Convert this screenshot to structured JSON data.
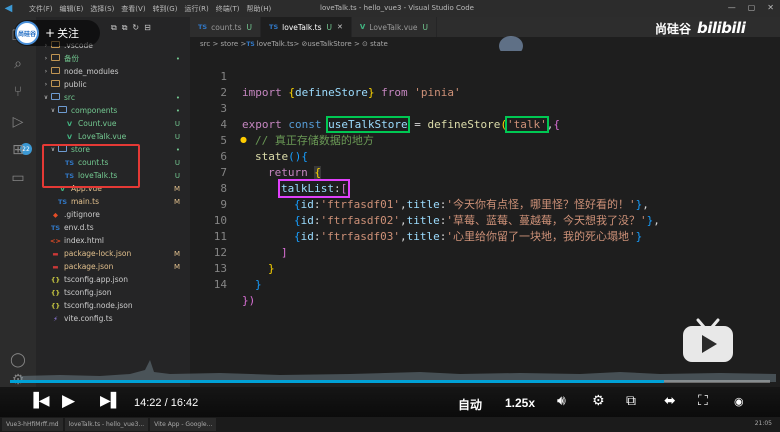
{
  "window": {
    "title": "loveTalk.ts - hello_vue3 - Visual Studio Code",
    "menu": [
      "文件(F)",
      "编辑(E)",
      "选择(S)",
      "查看(V)",
      "转到(G)",
      "运行(R)",
      "终端(T)",
      "帮助(H)"
    ]
  },
  "follow": {
    "avatar_text": "尚硅谷",
    "label": "关注",
    "plus": "+"
  },
  "brand": {
    "name": "尚硅谷",
    "logo": "bilibili"
  },
  "tabs": [
    {
      "label": "count.ts",
      "lang": "TS",
      "status": "U",
      "active": false
    },
    {
      "label": "loveTalk.ts",
      "lang": "TS",
      "status": "U",
      "active": true
    },
    {
      "label": "LoveTalk.vue",
      "lang": "V",
      "status": "U",
      "active": false
    }
  ],
  "breadcrumb": {
    "path": "src > store > ",
    "lang": "TS",
    "file": "loveTalk.ts",
    "rest": " > ⊘useTalkStore > ⊙ state"
  },
  "explorer": {
    "items": [
      {
        "name": ".vscode",
        "type": "folder",
        "chev": "›",
        "badge": ""
      },
      {
        "name": "备份",
        "type": "folder",
        "chev": "›",
        "badge": "•"
      },
      {
        "name": "node_modules",
        "type": "folder",
        "chev": "›",
        "badge": ""
      },
      {
        "name": "public",
        "type": "folder",
        "chev": "›",
        "badge": ""
      },
      {
        "name": "src",
        "type": "folder",
        "chev": "∨",
        "badge": "•"
      },
      {
        "name": "components",
        "type": "folder",
        "chev": "∨",
        "badge": "•"
      },
      {
        "name": "Count.vue",
        "type": "vue",
        "chev": "",
        "badge": "U"
      },
      {
        "name": "LoveTalk.vue",
        "type": "vue",
        "chev": "",
        "badge": "U"
      },
      {
        "name": "store",
        "type": "folder",
        "chev": "∨",
        "badge": "•"
      },
      {
        "name": "count.ts",
        "type": "ts",
        "chev": "",
        "badge": "U"
      },
      {
        "name": "loveTalk.ts",
        "type": "ts",
        "chev": "",
        "badge": "U"
      },
      {
        "name": "App.vue",
        "type": "vue",
        "chev": "",
        "badge": "M"
      },
      {
        "name": "main.ts",
        "type": "ts",
        "chev": "",
        "badge": "M"
      },
      {
        "name": ".gitignore",
        "type": "git",
        "chev": "",
        "badge": ""
      },
      {
        "name": "env.d.ts",
        "type": "ts",
        "chev": "",
        "badge": ""
      },
      {
        "name": "index.html",
        "type": "html",
        "chev": "",
        "badge": ""
      },
      {
        "name": "package-lock.json",
        "type": "npm",
        "chev": "",
        "badge": "M"
      },
      {
        "name": "package.json",
        "type": "npm",
        "chev": "",
        "badge": "M"
      },
      {
        "name": "tsconfig.app.json",
        "type": "json",
        "chev": "",
        "badge": ""
      },
      {
        "name": "tsconfig.json",
        "type": "json",
        "chev": "",
        "badge": ""
      },
      {
        "name": "tsconfig.node.json",
        "type": "json",
        "chev": "",
        "badge": ""
      },
      {
        "name": "vite.config.ts",
        "type": "vite",
        "chev": "",
        "badge": ""
      }
    ]
  },
  "code": {
    "line_numbers": [
      "1",
      "2",
      "3",
      "4",
      "5",
      "6",
      "7",
      "8",
      "9",
      "10",
      "11",
      "12",
      "13",
      "14"
    ],
    "l1": {
      "import": "import",
      "open": " {",
      "name": "defineStore",
      "close": "} ",
      "from": "from",
      "module": "'pinia'"
    },
    "l3": {
      "export": "export",
      "const": "const",
      "store_name": "useTalkStore",
      "eq": " = ",
      "define": "defineStore",
      "paren": "(",
      "id": "'talk'",
      "comma": ",",
      "brace": "{"
    },
    "l4": {
      "comment": "// 真正存储数据的地方"
    },
    "l5": {
      "state": "state",
      "paren": "()",
      "brace": "{"
    },
    "l6": {
      "return": "return",
      "brace": "{"
    },
    "l7": {
      "key": "talkList",
      "colon": ":",
      "bracket": "["
    },
    "rows": [
      {
        "open": "{",
        "id_key": "id",
        "id_val": "'ftrfasdf01'",
        "title_key": "title",
        "title_val": "'今天你有点怪，哪里怪？怪好看的！'",
        "close": "}",
        "comma": ","
      },
      {
        "open": "{",
        "id_key": "id",
        "id_val": "'ftrfasdf02'",
        "title_key": "title",
        "title_val": "'草莓、蓝莓、蔓越莓，今天想我了没？'",
        "close": "}",
        "comma": ","
      },
      {
        "open": "{",
        "id_key": "id",
        "id_val": "'ftrfasdf03'",
        "title_key": "title",
        "title_val": "'心里给你留了一块地，我的死心塌地'",
        "close": "}",
        "comma": ""
      }
    ],
    "l11": "]",
    "l12": "}",
    "l13": "}",
    "l14": "})"
  },
  "player": {
    "current_time": "14:22",
    "total_time": "16:42",
    "time_sep": " / ",
    "progress_fraction": 0.86,
    "quality": "自动",
    "speed": "1.25x"
  },
  "taskbar": {
    "items": [
      "Vue3-hHfiMrff.md",
      "loveTalk.ts - hello_vue3...",
      "Vite App - Google..."
    ],
    "clock": "21:05"
  },
  "colors": {
    "accent": "#00a1d6",
    "highlight_green": "#00c853",
    "highlight_magenta": "#e040fb",
    "highlight_red": "#e53935"
  }
}
